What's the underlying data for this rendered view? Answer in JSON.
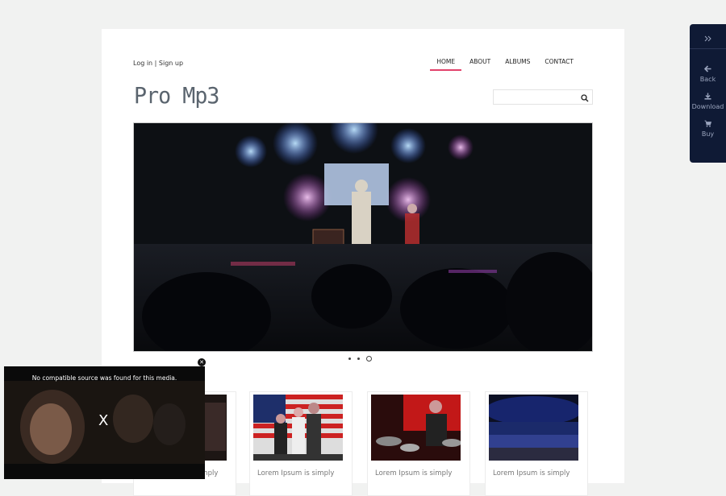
{
  "header": {
    "login_label": "Log in",
    "separator": "|",
    "signup_label": "Sign up",
    "logo_text": "Pro Mp3"
  },
  "nav": {
    "items": [
      {
        "label": "HOME",
        "active": true
      },
      {
        "label": "ABOUT",
        "active": false
      },
      {
        "label": "ALBUMS",
        "active": false
      },
      {
        "label": "CONTACT",
        "active": false
      }
    ]
  },
  "search": {
    "placeholder": "",
    "icon": "search-icon"
  },
  "slider": {
    "dot_count": 3,
    "active_index": 2
  },
  "albums": [
    {
      "title": "Lorem Ipsum is simply"
    },
    {
      "title": "Lorem Ipsum is simply"
    },
    {
      "title": "Lorem Ipsum is simply"
    },
    {
      "title": "Lorem Ipsum is simply"
    }
  ],
  "side_panel": {
    "toggle_icon": "double-chevron-right-icon",
    "actions": [
      {
        "label": "Back",
        "icon": "arrow-left-icon"
      },
      {
        "label": "Download",
        "icon": "download-icon"
      },
      {
        "label": "Buy",
        "icon": "cart-icon"
      }
    ]
  },
  "video_popup": {
    "message": "No compatible source was found for this media.",
    "x_label": "X",
    "close_label": "✕"
  },
  "colors": {
    "accent": "#e2426b",
    "side_panel_bg": "#0f1a35",
    "page_bg": "#f1f2f1"
  }
}
